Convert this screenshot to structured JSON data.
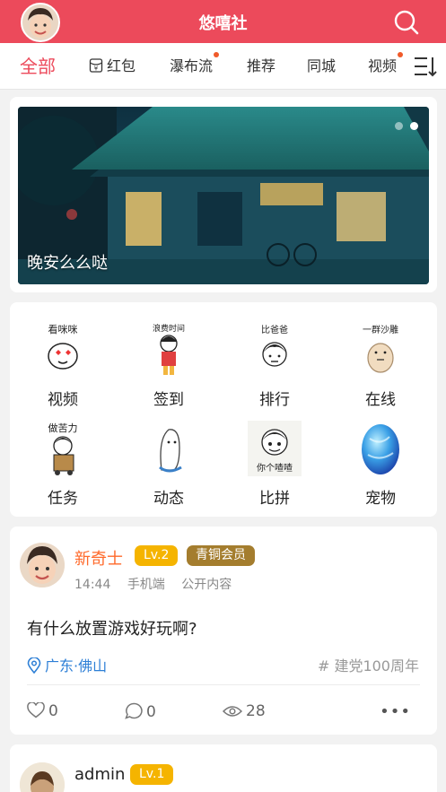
{
  "header": {
    "title": "悠嘻社"
  },
  "tabs": [
    {
      "label": "全部",
      "active": true,
      "dot": false
    },
    {
      "label": "红包",
      "active": false,
      "dot": false,
      "icon": "red-envelope-icon"
    },
    {
      "label": "瀑布流",
      "active": false,
      "dot": true
    },
    {
      "label": "推荐",
      "active": false,
      "dot": false
    },
    {
      "label": "同城",
      "active": false,
      "dot": false
    },
    {
      "label": "视频",
      "active": false,
      "dot": true
    }
  ],
  "banner": {
    "caption": "晚安么么哒",
    "page_index": 2,
    "page_count": 2
  },
  "grid": [
    {
      "label": "视频",
      "art_text": "看咪咪"
    },
    {
      "label": "签到",
      "art_text": "浪费时间"
    },
    {
      "label": "排行",
      "art_text": "比爸爸"
    },
    {
      "label": "在线",
      "art_text": "一群沙雕"
    },
    {
      "label": "任务",
      "art_text": "做苦力"
    },
    {
      "label": "动态",
      "art_text": ""
    },
    {
      "label": "比拼",
      "art_text": "你个喳喳"
    },
    {
      "label": "宠物",
      "art_text": ""
    }
  ],
  "posts": [
    {
      "username": "新奇士",
      "level": "Lv.2",
      "vip": "青铜会员",
      "time": "14:44",
      "device": "手机端",
      "visibility": "公开内容",
      "content": "有什么放置游戏好玩啊?",
      "location": "广东·佛山",
      "tag": "# 建党100周年",
      "likes": "0",
      "comments": "0",
      "views": "28"
    },
    {
      "username": "admin",
      "level": "Lv.1"
    }
  ],
  "colors": {
    "brand": "#ec4a5b",
    "location": "#2d7fd6",
    "level_badge": "#f5b400",
    "vip_badge": "#a47d2e"
  }
}
